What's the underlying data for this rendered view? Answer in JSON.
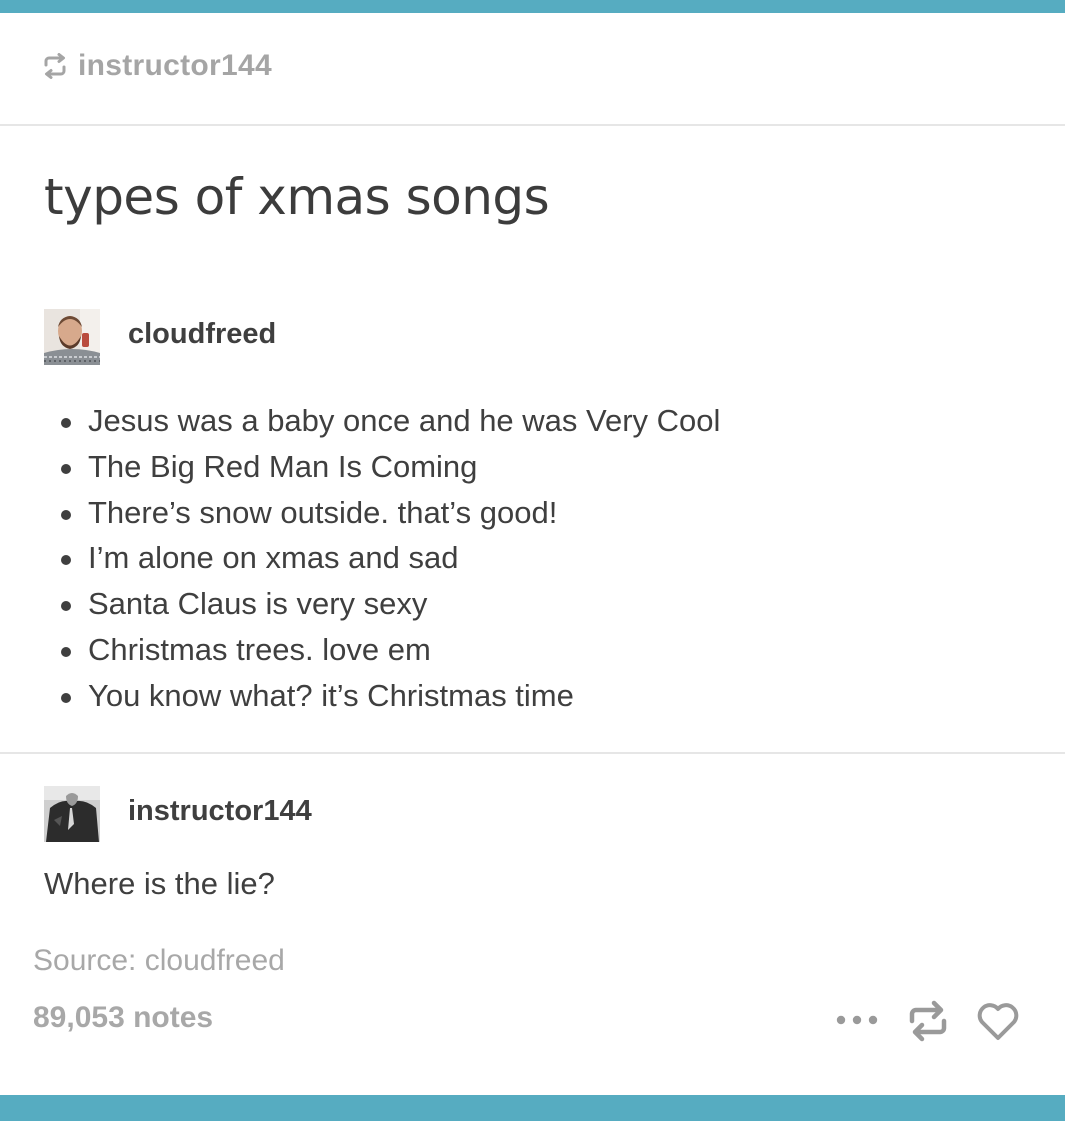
{
  "reblog_header": {
    "username": "instructor144",
    "icon": "reblog-icon"
  },
  "post": {
    "title": "types of xmas songs"
  },
  "original_post": {
    "username": "cloudfreed",
    "avatar": "bearded-man-avatar",
    "songs": [
      "Jesus was a baby once and he was Very Cool",
      "The Big Red Man Is Coming",
      "There’s snow outside. that’s good!",
      "I’m alone on xmas and sad",
      "Santa Claus is very sexy",
      "Christmas trees. love em",
      "You know what? it’s Christmas time"
    ]
  },
  "reply": {
    "username": "instructor144",
    "avatar": "dark-figure-avatar",
    "text": "Where is the lie?"
  },
  "footer": {
    "source": "Source: cloudfreed",
    "notes": "89,053 notes",
    "actions": [
      "more-icon",
      "reblog-icon",
      "heart-icon"
    ]
  },
  "colors": {
    "accent_bar": "#56acc1",
    "muted_text": "#a8a8a8",
    "body_text": "#3f3f3f",
    "divider": "#e6e6e6"
  }
}
